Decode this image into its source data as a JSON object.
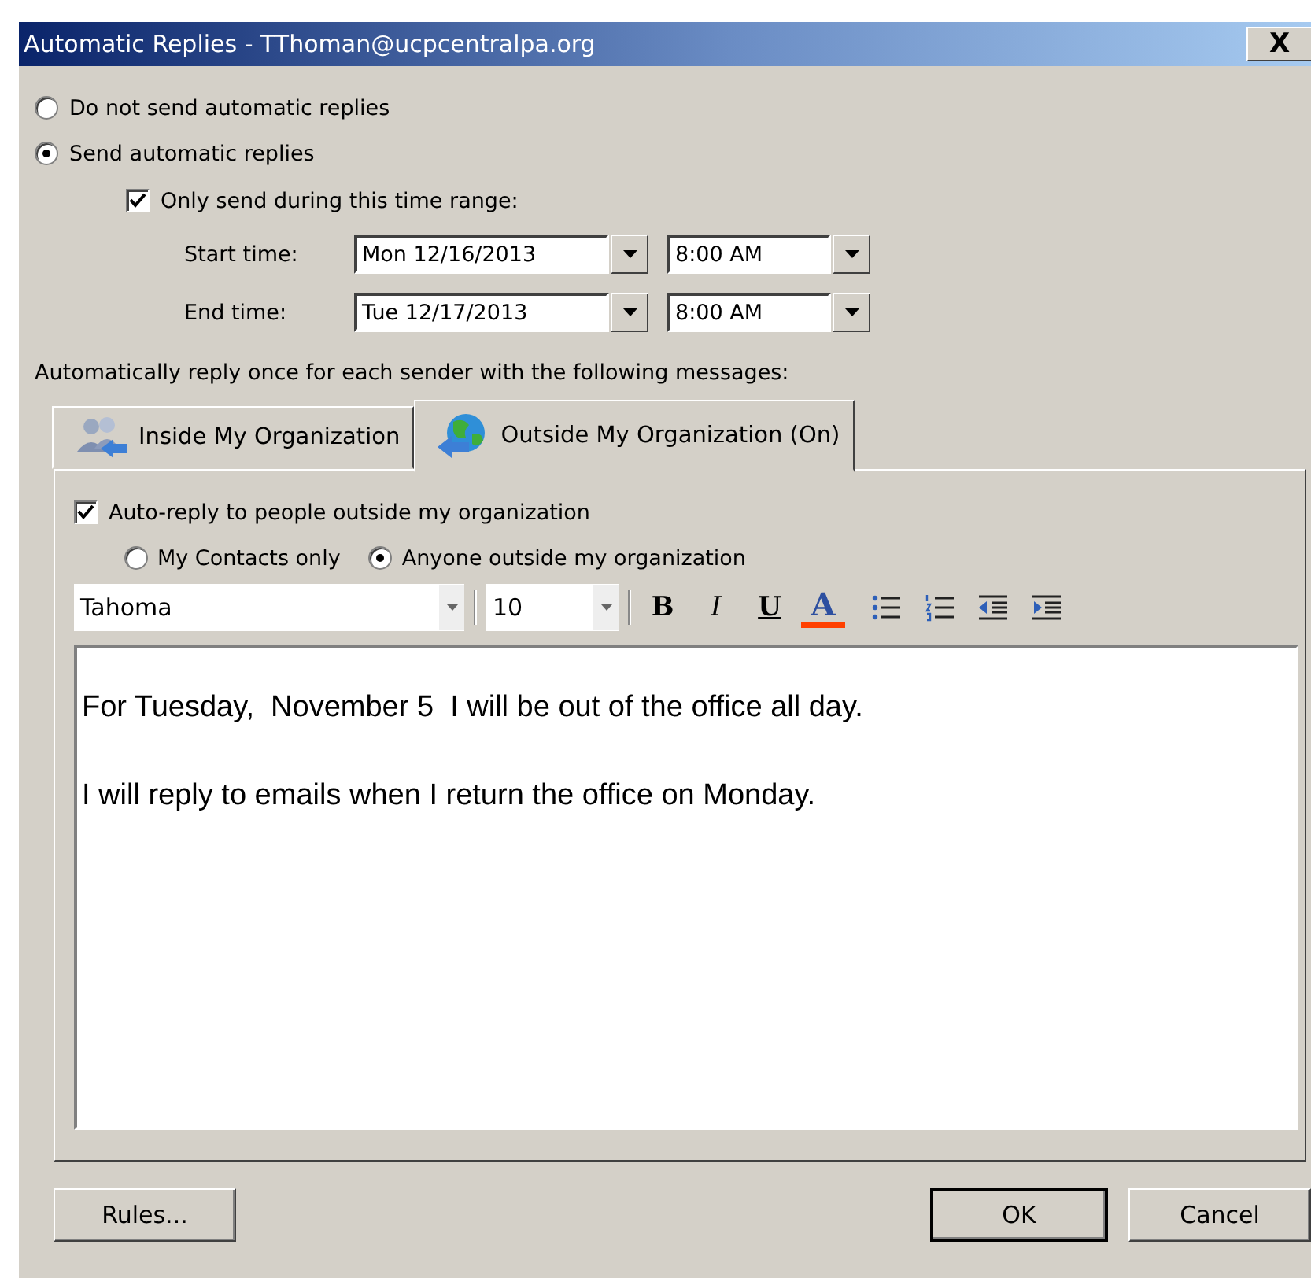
{
  "window": {
    "title": "Automatic Replies - TThoman@ucpcentralpa.org",
    "close": "X"
  },
  "reply_mode": [
    {
      "label": "Do not send automatic replies",
      "selected": false
    },
    {
      "label": "Send automatic replies",
      "selected": true
    }
  ],
  "time_range": {
    "label": "Only send during this time range:",
    "checked": true
  },
  "times": [
    {
      "label": "Start time:",
      "date": "Mon 12/16/2013",
      "time": "8:00 AM"
    },
    {
      "label": "End time:",
      "date": "Tue 12/17/2013",
      "time": "8:00 AM"
    }
  ],
  "tabs_label": "Automatically reply once for each sender with the following messages:",
  "tabs": [
    {
      "label": "Inside My Organization",
      "selected": false,
      "kind": "people"
    },
    {
      "label": "Outside My Organization (On)",
      "selected": true,
      "kind": "globe"
    }
  ],
  "outside": {
    "auto_reply": {
      "label": "Auto-reply to people outside my organization",
      "checked": true
    },
    "audience": [
      {
        "label": "My Contacts only",
        "selected": false
      },
      {
        "label": "Anyone outside my organization",
        "selected": true
      }
    ]
  },
  "toolbar": {
    "font": "Tahoma",
    "size": "10",
    "buttons": [
      {
        "kind": "bold",
        "label": "B"
      },
      {
        "kind": "italic",
        "label": "I"
      },
      {
        "kind": "underline",
        "label": "U"
      },
      {
        "kind": "color",
        "label": "A",
        "color": "#ff4000"
      },
      {
        "kind": "bullets"
      },
      {
        "kind": "numbering"
      },
      {
        "kind": "outdent"
      },
      {
        "kind": "indent"
      }
    ]
  },
  "message": [
    "For Tuesday,  November 5  I will be out of the office all day.",
    "I will reply to emails when I return the office on Monday."
  ],
  "buttons": [
    {
      "label": "Rules..."
    },
    {
      "label": "OK"
    },
    {
      "label": "Cancel"
    }
  ]
}
